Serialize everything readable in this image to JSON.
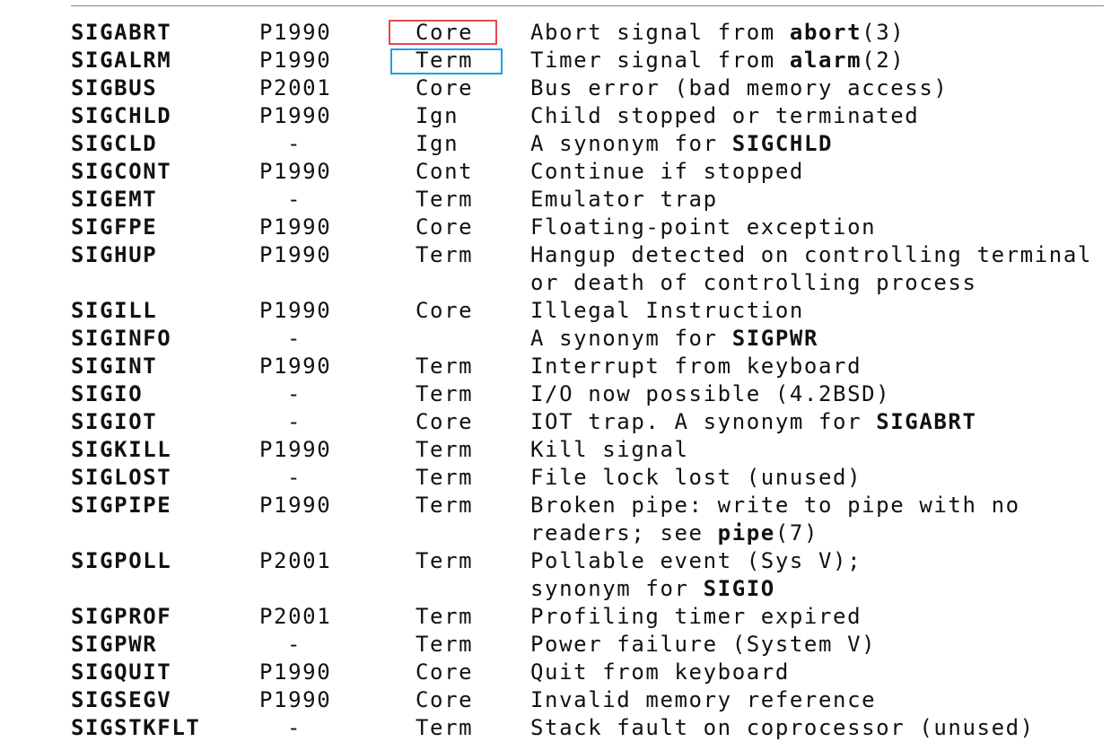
{
  "highlight_colors": {
    "red_box": "#e8474c",
    "blue_box": "#1da1e3"
  },
  "rows": [
    {
      "name": "SIGABRT",
      "std": "P1990",
      "action": "Core",
      "desc": [
        "Abort signal from ",
        {
          "b": "abort"
        },
        "(3)"
      ]
    },
    {
      "name": "SIGALRM",
      "std": "P1990",
      "action": "Term",
      "desc": [
        "Timer signal from ",
        {
          "b": "alarm"
        },
        "(2)"
      ]
    },
    {
      "name": "SIGBUS",
      "std": "P2001",
      "action": "Core",
      "desc": [
        "Bus error (bad memory access)"
      ]
    },
    {
      "name": "SIGCHLD",
      "std": "P1990",
      "action": "Ign",
      "desc": [
        "Child stopped or terminated"
      ]
    },
    {
      "name": "SIGCLD",
      "std": "-",
      "action": "Ign",
      "desc": [
        "A synonym for ",
        {
          "b": "SIGCHLD"
        }
      ]
    },
    {
      "name": "SIGCONT",
      "std": "P1990",
      "action": "Cont",
      "desc": [
        "Continue if stopped"
      ]
    },
    {
      "name": "SIGEMT",
      "std": "-",
      "action": "Term",
      "desc": [
        "Emulator trap"
      ]
    },
    {
      "name": "SIGFPE",
      "std": "P1990",
      "action": "Core",
      "desc": [
        "Floating-point exception"
      ]
    },
    {
      "name": "SIGHUP",
      "std": "P1990",
      "action": "Term",
      "desc": [
        "Hangup detected on controlling terminal"
      ]
    },
    {
      "name": "",
      "std": "",
      "action": "",
      "desc": [
        "or death of controlling process"
      ]
    },
    {
      "name": "SIGILL",
      "std": "P1990",
      "action": "Core",
      "desc": [
        "Illegal Instruction"
      ]
    },
    {
      "name": "SIGINFO",
      "std": "-",
      "action": "",
      "desc": [
        "A synonym for ",
        {
          "b": "SIGPWR"
        }
      ]
    },
    {
      "name": "SIGINT",
      "std": "P1990",
      "action": "Term",
      "desc": [
        "Interrupt from keyboard"
      ]
    },
    {
      "name": "SIGIO",
      "std": "-",
      "action": "Term",
      "desc": [
        "I/O now possible (4.2BSD)"
      ]
    },
    {
      "name": "SIGIOT",
      "std": "-",
      "action": "Core",
      "desc": [
        "IOT trap. A synonym for ",
        {
          "b": "SIGABRT"
        }
      ]
    },
    {
      "name": "SIGKILL",
      "std": "P1990",
      "action": "Term",
      "desc": [
        "Kill signal"
      ]
    },
    {
      "name": "SIGLOST",
      "std": "-",
      "action": "Term",
      "desc": [
        "File lock lost (unused)"
      ]
    },
    {
      "name": "SIGPIPE",
      "std": "P1990",
      "action": "Term",
      "desc": [
        "Broken pipe: write to pipe with no"
      ]
    },
    {
      "name": "",
      "std": "",
      "action": "",
      "desc": [
        "readers; see ",
        {
          "b": "pipe"
        },
        "(7)"
      ]
    },
    {
      "name": "SIGPOLL",
      "std": "P2001",
      "action": "Term",
      "desc": [
        "Pollable event (Sys V);"
      ]
    },
    {
      "name": "",
      "std": "",
      "action": "",
      "desc": [
        "synonym for ",
        {
          "b": "SIGIO"
        }
      ]
    },
    {
      "name": "SIGPROF",
      "std": "P2001",
      "action": "Term",
      "desc": [
        "Profiling timer expired"
      ]
    },
    {
      "name": "SIGPWR",
      "std": "-",
      "action": "Term",
      "desc": [
        "Power failure (System V)"
      ]
    },
    {
      "name": "SIGQUIT",
      "std": "P1990",
      "action": "Core",
      "desc": [
        "Quit from keyboard"
      ]
    },
    {
      "name": "SIGSEGV",
      "std": "P1990",
      "action": "Core",
      "desc": [
        "Invalid memory reference"
      ]
    },
    {
      "name": "SIGSTKFLT",
      "std": "-",
      "action": "Term",
      "desc": [
        "Stack fault on coprocessor (unused)"
      ]
    }
  ]
}
